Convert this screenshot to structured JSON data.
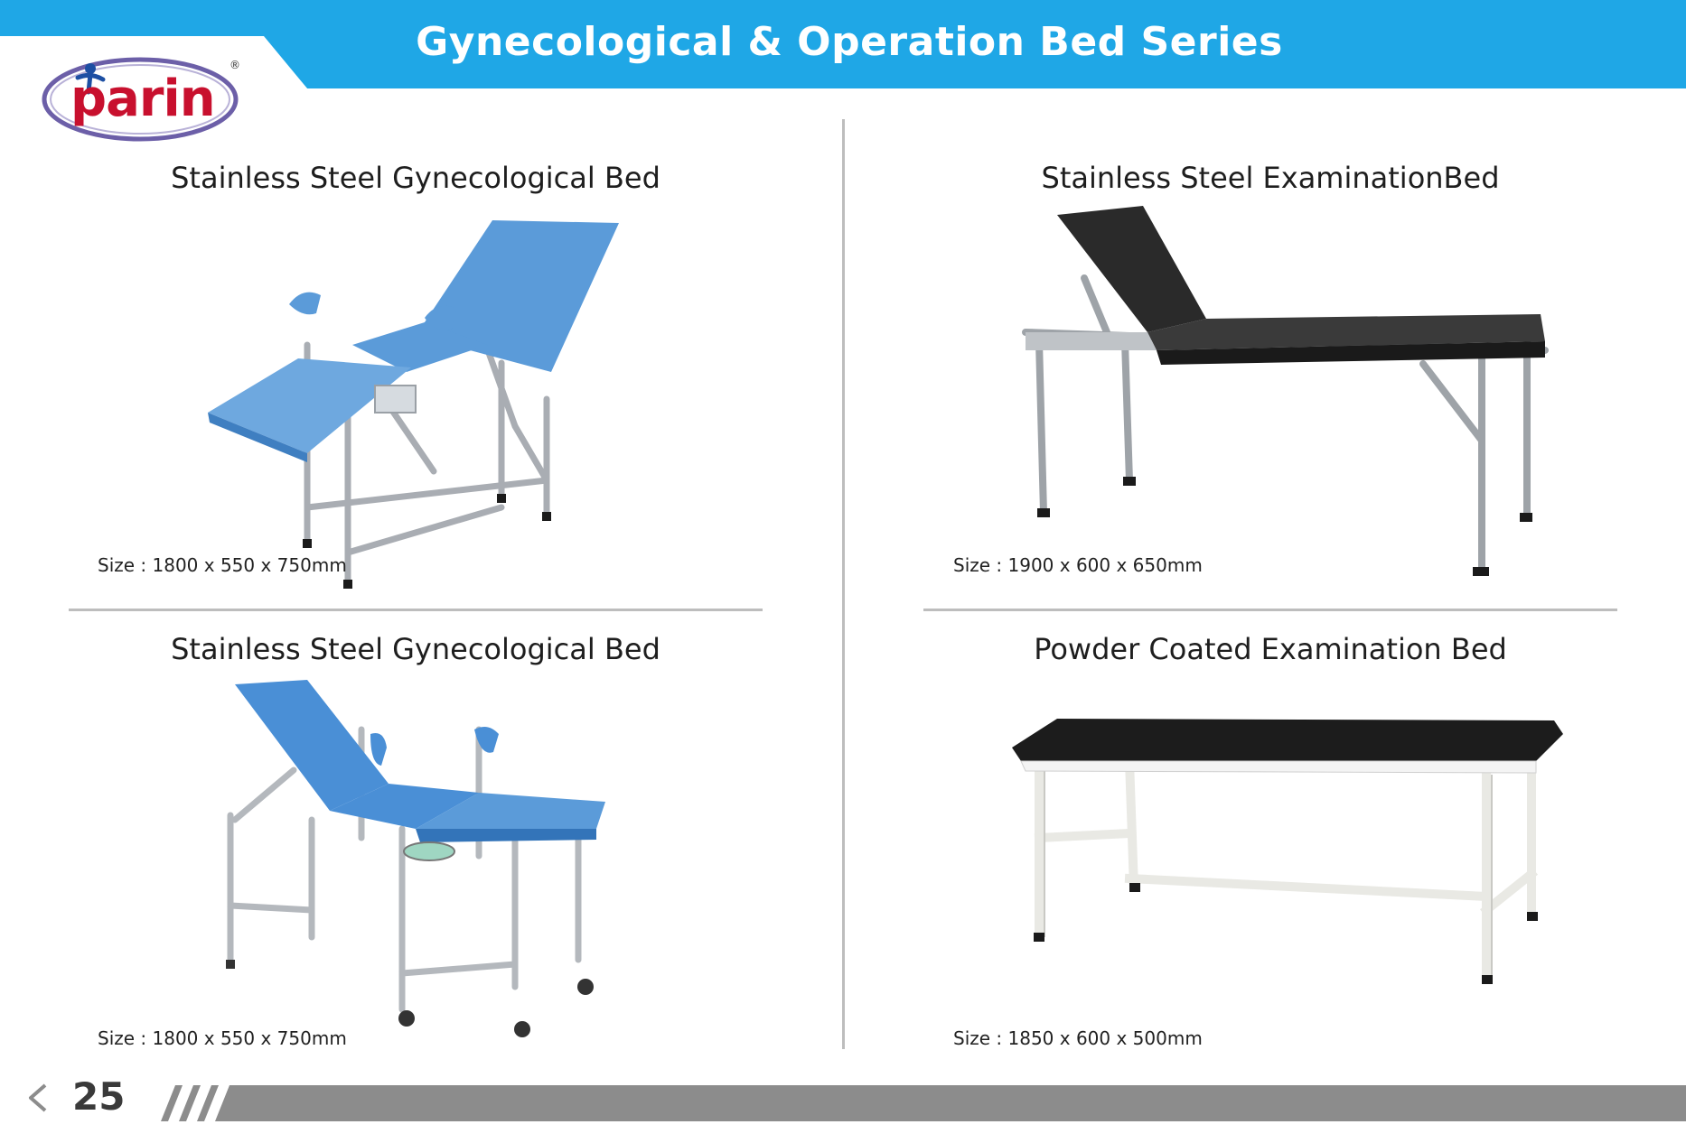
{
  "header": {
    "title": "Gynecological & Operation Bed Series",
    "band_color": "#1fa7e6"
  },
  "logo": {
    "brand": "parin",
    "registered_mark": "®",
    "brand_color": "#c8102e",
    "ring_color": "#6c5fa8",
    "figure_color": "#1d4fa3"
  },
  "products": [
    {
      "title": "Stainless Steel Gynecological Bed",
      "size": "Size : 1800 x 550 x 750mm",
      "cushion_color": "#5b9bd9",
      "frame": "stainless-steel"
    },
    {
      "title": "Stainless Steel ExaminationBed",
      "size": "Size : 1900 x 600 x 650mm",
      "cushion_color": "#2a2a2a",
      "frame": "stainless-steel"
    },
    {
      "title": "Stainless Steel Gynecological Bed",
      "size": "Size : 1800 x 550 x 750mm",
      "cushion_color": "#4a8fd6",
      "frame": "stainless-steel"
    },
    {
      "title": "Powder Coated Examination Bed",
      "size": "Size : 1850 x 600 x 500mm",
      "cushion_color": "#1c1c1c",
      "frame": "white-powder-coated"
    }
  ],
  "footer": {
    "page_number": "25",
    "bar_color": "#8c8c8c",
    "back_icon": "chevron-left-icon"
  }
}
